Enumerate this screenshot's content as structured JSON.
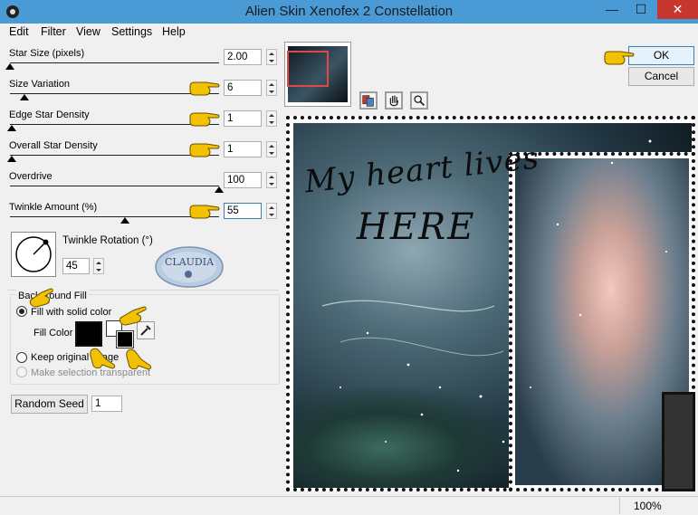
{
  "window": {
    "title": "Alien Skin Xenofex 2 Constellation"
  },
  "titlebar": {
    "minimize": "—",
    "maximize": "☐",
    "close": "✕"
  },
  "menu": [
    "Edit",
    "Filter",
    "View",
    "Settings",
    "Help"
  ],
  "sliders": [
    {
      "label": "Star Size (pixels)",
      "value": "2.00",
      "level": 0.0
    },
    {
      "label": "Size Variation",
      "value": "6",
      "level": 0.07
    },
    {
      "label": "Edge Star Density",
      "value": "1",
      "level": 0.01
    },
    {
      "label": "Overall Star Density",
      "value": "1",
      "level": 0.01
    },
    {
      "label": "Overdrive",
      "value": "100",
      "level": 1.0
    },
    {
      "label": "Twinkle Amount (%)",
      "value": "55",
      "level": 0.55
    }
  ],
  "twinkle_rotation": {
    "label": "Twinkle Rotation (°)",
    "value": "45"
  },
  "badge": {
    "text": "CLAUDIA"
  },
  "background_fill": {
    "group_label": "Background Fill",
    "fill_solid": "Fill with solid color",
    "fill_color_label": "Fill Color",
    "keep_original": "Keep original image",
    "make_transparent": "Make selection transparent",
    "fill_color": "#000000"
  },
  "random_seed": {
    "button": "Random Seed",
    "value": "1"
  },
  "buttons": {
    "ok": "OK",
    "cancel": "Cancel"
  },
  "preview": {
    "line1": "My heart lives",
    "line2": "HERE"
  },
  "status": {
    "zoom": "100%"
  },
  "colors": {
    "titlebar": "#4a9ad6",
    "close": "#c7372f",
    "hand": "#f2c200",
    "preview_bg": "#2c4a5a"
  }
}
